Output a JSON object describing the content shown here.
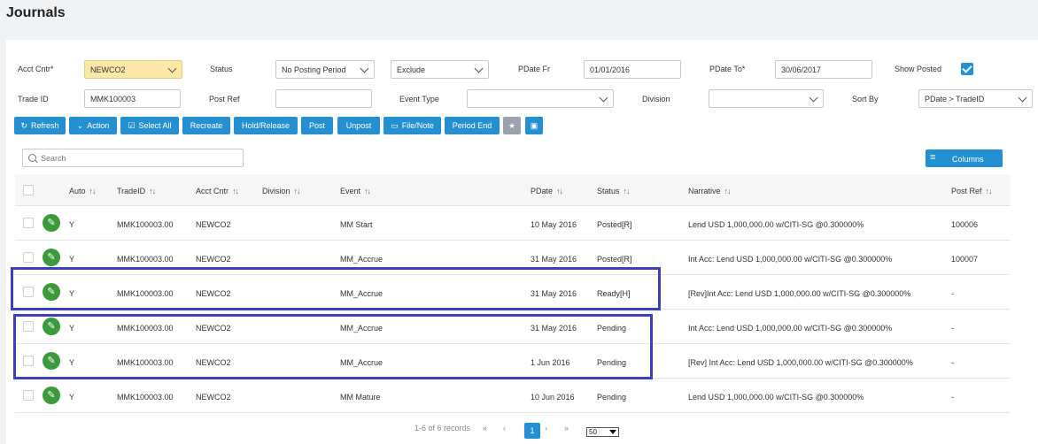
{
  "page": {
    "title": "Journals"
  },
  "filters": {
    "acct_cntr": {
      "label": "Acct Cntr*",
      "value": "NEWCO2"
    },
    "status": {
      "label": "Status",
      "value": "No Posting Period"
    },
    "exclude": {
      "value": "Exclude"
    },
    "pdate_fr": {
      "label": "PDate Fr",
      "value": "01/01/2016"
    },
    "pdate_to": {
      "label": "PDate To*",
      "value": "30/06/2017"
    },
    "show_posted": {
      "label": "Show Posted",
      "checked": true
    },
    "trade_id": {
      "label": "Trade ID",
      "value": "MMK100003"
    },
    "post_ref": {
      "label": "Post Ref",
      "value": ""
    },
    "event_type": {
      "label": "Event Type",
      "value": ""
    },
    "division": {
      "label": "Division",
      "value": ""
    },
    "sort_by": {
      "label": "Sort By",
      "value": "PDate > TradeID"
    }
  },
  "toolbar": {
    "refresh": "Refresh",
    "action": "Action",
    "select_all": "Select All",
    "recreate": "Recreate",
    "hold_release": "Hold/Release",
    "post": "Post",
    "unpost": "Unpost",
    "file_note": "File/Note",
    "period_end": "Period End"
  },
  "search": {
    "placeholder": "Search",
    "value": ""
  },
  "columns_button": "Columns",
  "table": {
    "headers": {
      "auto": "Auto",
      "trade_id": "TradeID",
      "acct_cntr": "Acct Cntr",
      "division": "Division",
      "event": "Event",
      "pdate": "PDate",
      "status": "Status",
      "narrative": "Narrative",
      "post_ref": "Post Ref"
    },
    "rows": [
      {
        "auto": "Y",
        "trade_id": "MMK100003.00",
        "acct_cntr": "NEWCO2",
        "division": "",
        "event": "MM Start",
        "pdate": "10 May 2016",
        "status": "Posted[R]",
        "narrative": "Lend USD 1,000,000.00 w/CITI-SG @0.300000%",
        "post_ref": "100006"
      },
      {
        "auto": "Y",
        "trade_id": "MMK100003.00",
        "acct_cntr": "NEWCO2",
        "division": "",
        "event": "MM_Accrue",
        "pdate": "31 May 2016",
        "status": "Posted[R]",
        "narrative": "Int Acc: Lend USD 1,000,000.00 w/CITI-SG @0.300000%",
        "post_ref": "100007"
      },
      {
        "auto": "Y",
        "trade_id": "MMK100003.00",
        "acct_cntr": "NEWCO2",
        "division": "",
        "event": "MM_Accrue",
        "pdate": "31 May 2016",
        "status": "Ready[H]",
        "narrative": "[Rev]Int Acc: Lend USD 1,000,000.00 w/CITI-SG @0.300000%",
        "post_ref": "-"
      },
      {
        "auto": "Y",
        "trade_id": "MMK100003.00",
        "acct_cntr": "NEWCO2",
        "division": "",
        "event": "MM_Accrue",
        "pdate": "31 May 2016",
        "status": "Pending",
        "narrative": "Int Acc: Lend USD 1,000,000.00 w/CITI-SG @0.300000%",
        "post_ref": "-"
      },
      {
        "auto": "Y",
        "trade_id": "MMK100003.00",
        "acct_cntr": "NEWCO2",
        "division": "",
        "event": "MM_Accrue",
        "pdate": "1 Jun 2016",
        "status": "Pending",
        "narrative": "[Rev] Int Acc: Lend USD 1,000,000.00 w/CITI-SG @0.300000%",
        "post_ref": "-"
      },
      {
        "auto": "Y",
        "trade_id": "MMK100003.00",
        "acct_cntr": "NEWCO2",
        "division": "",
        "event": "MM Mature",
        "pdate": "10 Jun 2016",
        "status": "Pending",
        "narrative": "Lend USD 1,000,000.00 w/CITI-SG @0.300000%",
        "post_ref": "-"
      }
    ]
  },
  "pagination": {
    "summary": "1-6 of 6 records",
    "first": "«",
    "prev": "‹",
    "current_page": "1",
    "next": "›",
    "last": "»",
    "page_size": "50"
  },
  "colors": {
    "accent": "#2490d1",
    "edit": "#3c9a3c",
    "highlight_field": "#fce8a6",
    "annotation_box": "#3b3fbd"
  },
  "icons": {
    "refresh": "refresh-icon",
    "action": "chevron-down-icon",
    "select_all": "checkbox-icon",
    "file_note": "folder-icon",
    "favorite": "star-icon",
    "save": "save-icon",
    "edit": "pencil-icon",
    "columns": "list-icon",
    "search": "search-icon"
  }
}
